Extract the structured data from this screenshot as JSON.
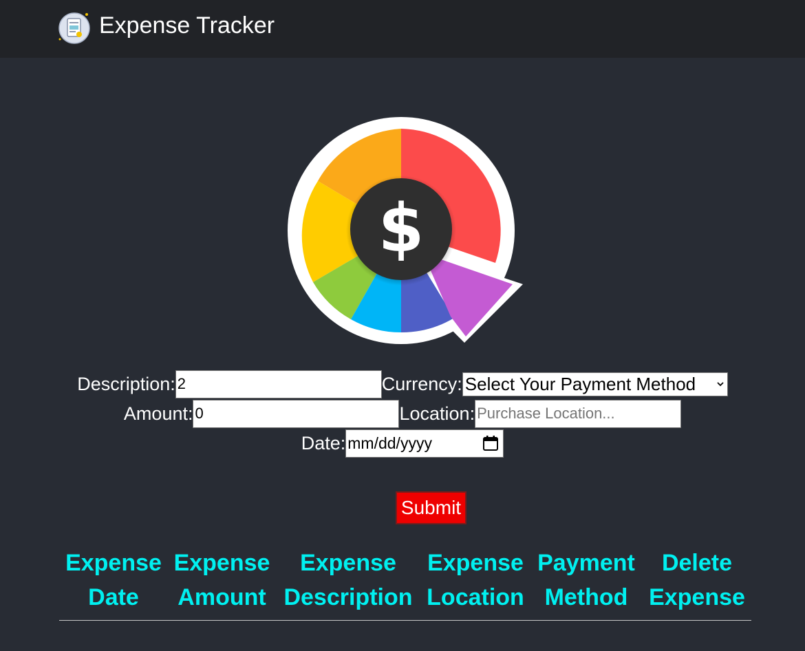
{
  "navbar": {
    "title": "Expense Tracker"
  },
  "form": {
    "description_label": "Description:",
    "description_value": "2",
    "currency_label": "Currency:",
    "currency_selected": "Select Your Payment Method",
    "amount_label": "Amount:",
    "amount_value": "0",
    "location_label": "Location:",
    "location_placeholder": "Purchase Location...",
    "date_label": "Date:",
    "date_placeholder": "mm/dd/yyyy",
    "submit_label": "Submit"
  },
  "table": {
    "headers": [
      {
        "line1": "Expense",
        "line2": "Date"
      },
      {
        "line1": "Expense",
        "line2": "Amount"
      },
      {
        "line1": "Expense",
        "line2": "Description"
      },
      {
        "line1": "Expense",
        "line2": "Location"
      },
      {
        "line1": "Payment",
        "line2": "Method"
      },
      {
        "line1": "Delete",
        "line2": "Expense"
      }
    ]
  },
  "colors": {
    "background": "#282c34",
    "navbar": "#212327",
    "header_text": "#00f0f0",
    "submit_button": "#ee0000"
  },
  "icons": {
    "brand": "receipt-icon",
    "hero": "expense-wheel-logo",
    "select": "chevron-down-icon",
    "date": "calendar-icon"
  }
}
